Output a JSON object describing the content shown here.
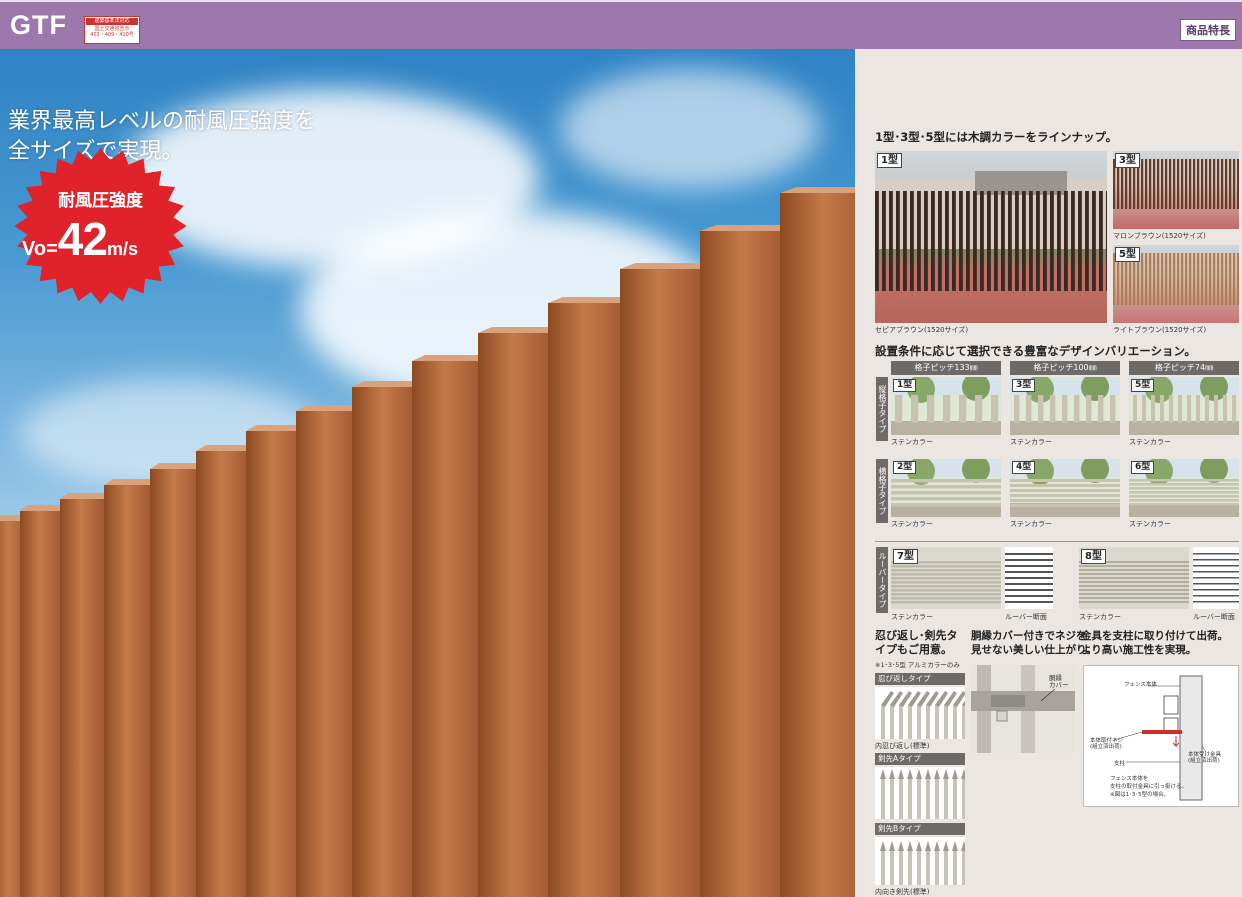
{
  "header": {
    "logo": "GTF",
    "cert_line1": "建築基準法対応",
    "cert_line2": "国土交通省告示",
    "cert_line3": "403・409・410号",
    "tag": "商品特長"
  },
  "hero": {
    "headline_line1": "業界最高レベルの耐風圧強度を",
    "headline_line2": "全サイズで実現。",
    "burst_title": "耐風圧強度",
    "burst_vo": "Vo=",
    "burst_value": "42",
    "burst_unit": "m/s"
  },
  "colors_section": {
    "title": "1型･3型･5型には木調カラーをラインナップ。",
    "photo1_label": "1型",
    "photo1_caption": "セピアブラウン(1520サイズ)",
    "photo3_label": "3型",
    "photo3_caption": "マロンブラウン(1520サイズ)",
    "photo5_label": "5型",
    "photo5_caption": "ライトブラウン(1520サイズ)"
  },
  "variation_section": {
    "title": "設置条件に応じて選択できる豊富なデザインバリエーション。",
    "pitch1": "格子ピッチ133㎜",
    "pitch2": "格子ピッチ100㎜",
    "pitch3": "格子ピッチ74㎜",
    "row1_label": "縦格子タイプ",
    "row2_label": "横格子タイプ",
    "row3_label": "ルーバータイプ",
    "types": [
      {
        "label": "1型",
        "caption": "ステンカラー"
      },
      {
        "label": "3型",
        "caption": "ステンカラー"
      },
      {
        "label": "5型",
        "caption": "ステンカラー"
      },
      {
        "label": "2型",
        "caption": "ステンカラー"
      },
      {
        "label": "4型",
        "caption": "ステンカラー"
      },
      {
        "label": "6型",
        "caption": "ステンカラー"
      }
    ],
    "louver7_label": "7型",
    "louver7_caption": "ステンカラー",
    "louver7_section_caption": "ルーバー断面",
    "louver8_label": "8型",
    "louver8_caption": "ステンカラー",
    "louver8_section_caption": "ルーバー断面"
  },
  "features": {
    "f1_title_line1": "忍び返し･剣先タ",
    "f1_title_line2": "イプもご用意。",
    "f1_note": "※1･3･5型 アルミカラーのみ",
    "f1_bar1": "忍び返しタイプ",
    "f1_cap1": "内忍び返し(標準)",
    "f1_bar2": "剣先Aタイプ",
    "f1_bar3": "剣先Bタイプ",
    "f1_cap3": "内向き剣先(標準)",
    "f2_title_line1": "胴縁カバー付きでネジを",
    "f2_title_line2": "見せない美しい仕上がり。",
    "f2_callout_line1": "胴縁",
    "f2_callout_line2": "カバー",
    "f3_title_line1": "金具を支柱に取り付けて出荷。",
    "f3_title_line2": "より高い施工性を実現。",
    "f3_d1": "フェンス本体",
    "f3_d2_line1": "本体取付ネジ",
    "f3_d2_line2": "(組立済出荷)",
    "f3_d3": "支柱",
    "f3_d4_line1": "本体受け金具",
    "f3_d4_line2": "(組立済出荷)",
    "f3_d5": "フェンス本体を",
    "f3_d6": "支柱の取付金具に引っ掛ける。",
    "f3_d7": "※図は1･3･5型の場合。"
  },
  "palette": {
    "header": "#9d78ad",
    "wood": "#b5683a",
    "burst": "#e0232a"
  }
}
